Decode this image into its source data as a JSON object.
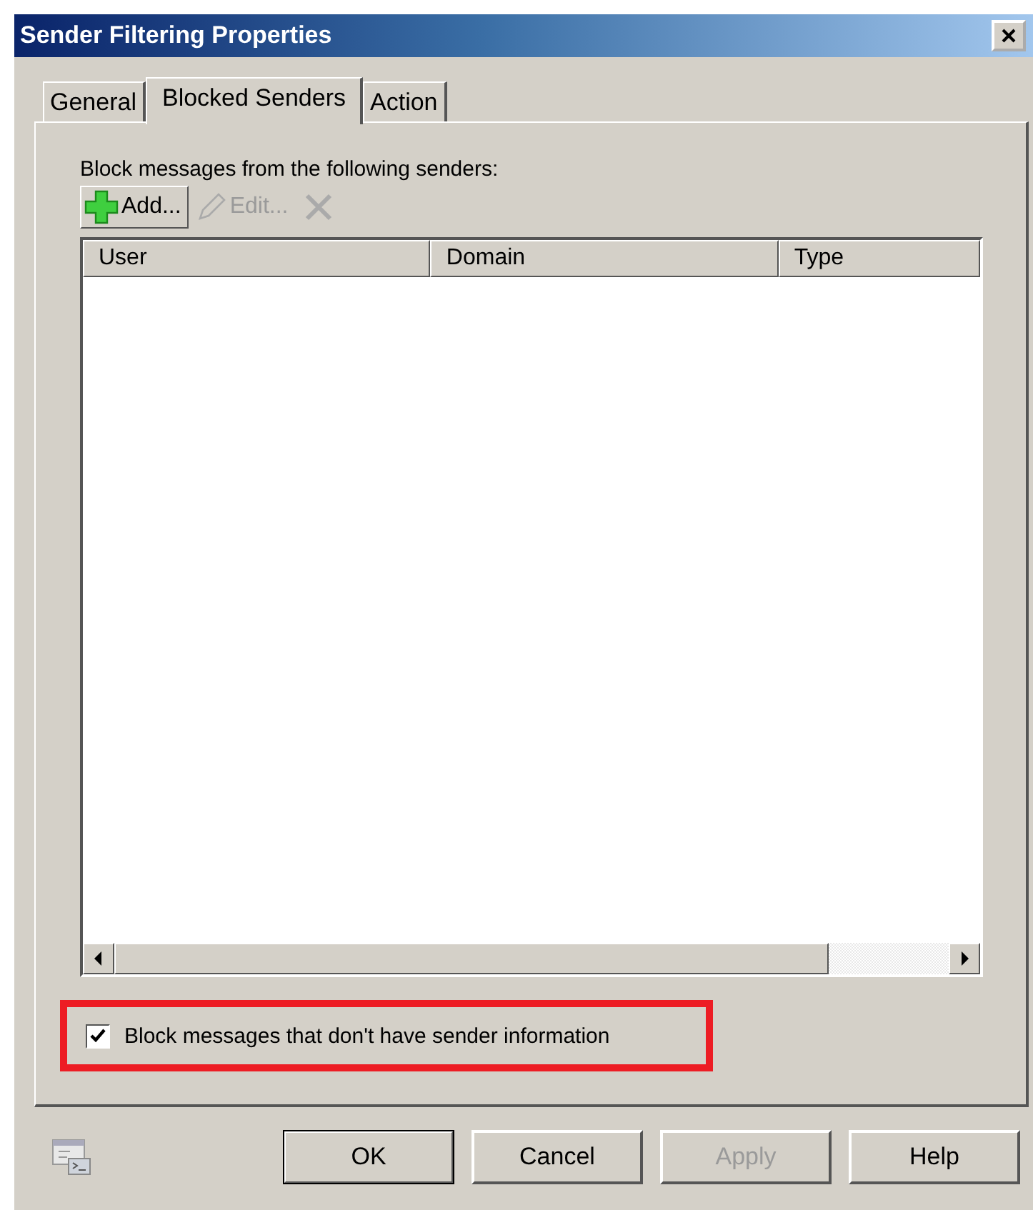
{
  "window": {
    "title": "Sender Filtering Properties"
  },
  "tabs": [
    {
      "label": "General",
      "selected": false
    },
    {
      "label": "Blocked Senders",
      "selected": true
    },
    {
      "label": "Action",
      "selected": false
    }
  ],
  "list_label": "Block messages from the following senders:",
  "toolbar": [
    {
      "kind": "add",
      "label": "Add...",
      "disabled": false
    },
    {
      "kind": "edit",
      "label": "Edit...",
      "disabled": true
    },
    {
      "kind": "remove",
      "disabled": true
    }
  ],
  "table": {
    "columns": [
      "User",
      "Domain",
      "Type"
    ]
  },
  "checkbox": {
    "label": "Block messages that don't have sender information",
    "checked": true,
    "highlighted": true
  },
  "buttons": [
    {
      "label": "OK",
      "default": true,
      "disabled": false
    },
    {
      "label": "Cancel",
      "default": false,
      "disabled": false
    },
    {
      "label": "Apply",
      "default": false,
      "disabled": true
    },
    {
      "label": "Help",
      "default": false,
      "disabled": false
    }
  ]
}
